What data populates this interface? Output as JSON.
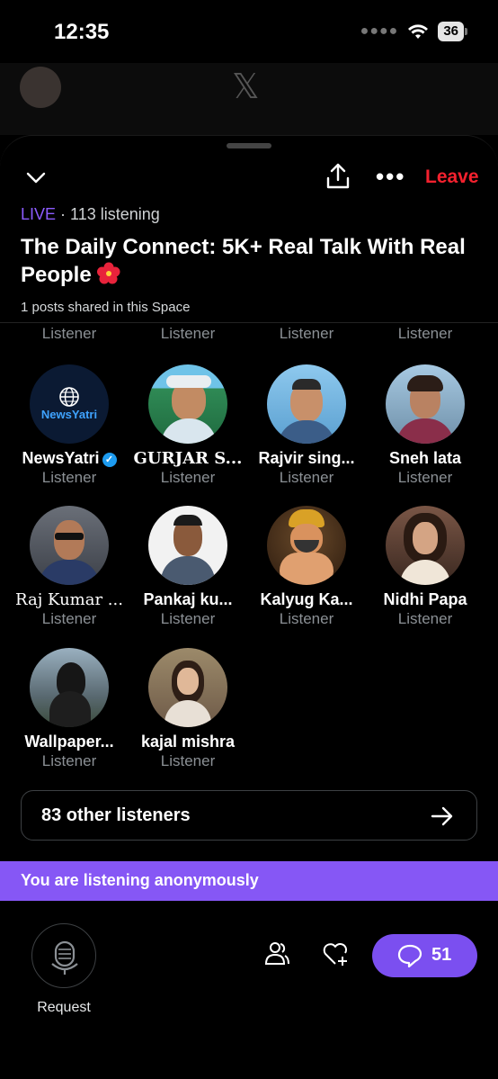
{
  "status": {
    "time": "12:35",
    "battery": "36"
  },
  "space": {
    "live_tag": "LIVE",
    "listening": "· 113 listening",
    "title": "The Daily Connect: 5K+ Real Talk With Real People",
    "shared": "1 posts shared in this Space",
    "leave_label": "Leave"
  },
  "ghost_row_role": "Listener",
  "people": [
    {
      "name": "NewsYatri",
      "role": "Listener",
      "verified": true,
      "avatar_text": "NewsYatri",
      "color": "#0b1a33"
    },
    {
      "name": "GURJAR S...",
      "role": "Listener",
      "color": "#2f8a55"
    },
    {
      "name": "Rajvir sing...",
      "role": "Listener",
      "color": "#7cb5d9"
    },
    {
      "name": "Sneh lata",
      "role": "Listener",
      "color": "#5a7a9a"
    },
    {
      "name": "Raj Kumar ...",
      "role": "Listener",
      "color": "#4b5566"
    },
    {
      "name": "Pankaj ku...",
      "role": "Listener",
      "color": "#d8d8d8"
    },
    {
      "name": "Kalyug Ka...",
      "role": "Listener",
      "color": "#c47a2c"
    },
    {
      "name": "Nidhi Papa",
      "role": "Listener",
      "color": "#6b4a3a"
    },
    {
      "name": "Wallpaper...",
      "role": "Listener",
      "color": "#4b5a66"
    },
    {
      "name": "kajal mishra",
      "role": "Listener",
      "color": "#8a6b5a"
    }
  ],
  "others_label": "83 other listeners",
  "anon_text": "You are listening anonymously",
  "request_label": "Request",
  "comments_count": "51",
  "colors": {
    "accent": "#8657f5",
    "leave": "#f4212e",
    "verified": "#1d9bf0"
  }
}
